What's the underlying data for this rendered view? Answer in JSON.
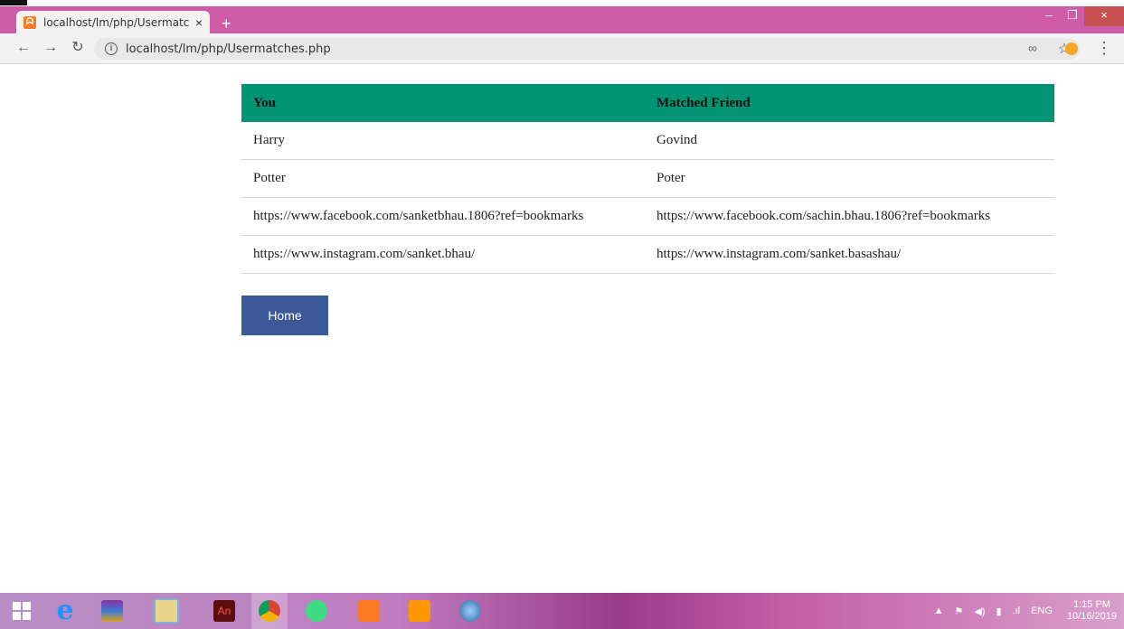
{
  "browser": {
    "tab_title": "localhost/lm/php/Usermatches.p",
    "tab_close": "×",
    "new_tab": "+",
    "url": "localhost/lm/php/Usermatches.php",
    "window_controls": {
      "minimize": "–",
      "restore": "❐",
      "close": "×"
    }
  },
  "table": {
    "headers": [
      "You",
      "Matched Friend"
    ],
    "rows": [
      [
        "Harry",
        "Govind"
      ],
      [
        "Potter",
        "Poter"
      ],
      [
        "https://www.facebook.com/sanketbhau.1806?ref=bookmarks",
        "https://www.facebook.com/sachin.bhau.1806?ref=bookmarks"
      ],
      [
        "https://www.instagram.com/sanket.bhau/",
        "https://www.instagram.com/sanket.basashau/"
      ]
    ],
    "header_color": "#009473"
  },
  "home_button": {
    "label": "Home",
    "color": "#3b5998"
  },
  "taskbar": {
    "apps": [
      "windows-start-icon",
      "internet-explorer-icon",
      "winrar-icon",
      "file-explorer-icon",
      "animate-icon",
      "chrome-icon",
      "android-studio-icon",
      "xampp-icon",
      "sublime-text-icon",
      "paint-icon"
    ],
    "language": "ENG",
    "time": "1:15 PM",
    "date": "10/16/2019"
  }
}
